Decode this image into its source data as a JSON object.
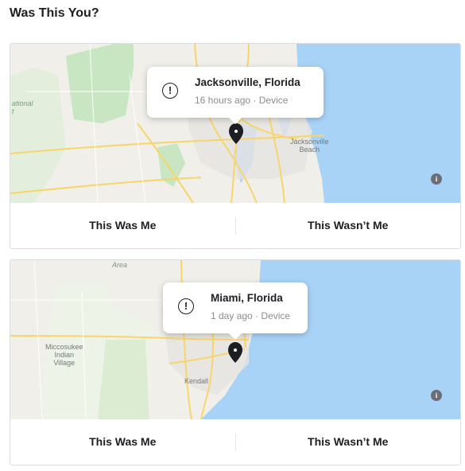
{
  "page": {
    "title": "Was This You?"
  },
  "logins": [
    {
      "city": "Jacksonville, Florida",
      "time": "16 hours ago",
      "separator": "·",
      "source": "Device",
      "map_labels": {
        "city_label_1": "Jacksonville",
        "city_label_2": "Beach",
        "park_label_1": "ational",
        "park_label_2": "t"
      },
      "confirm_label": "This Was Me",
      "deny_label": "This Wasn’t Me"
    },
    {
      "city": "Miami, Florida",
      "time": "1 day ago",
      "separator": "·",
      "source": "Device",
      "map_labels": {
        "area_label": "Area",
        "reserve_label_1": "Miccosukee",
        "reserve_label_2": "Indian",
        "reserve_label_3": "Village",
        "city_label": "Kendall"
      },
      "confirm_label": "This Was Me",
      "deny_label": "This Wasn’t Me"
    }
  ],
  "icons": {
    "alert": "alert-circle-icon",
    "pin": "map-pin-icon",
    "info": "info-icon"
  },
  "colors": {
    "water": "#a8d3f7",
    "land": "#f0efea",
    "park": "#c9e6c3",
    "road": "#f7d56a",
    "pin": "#1c1e21"
  }
}
